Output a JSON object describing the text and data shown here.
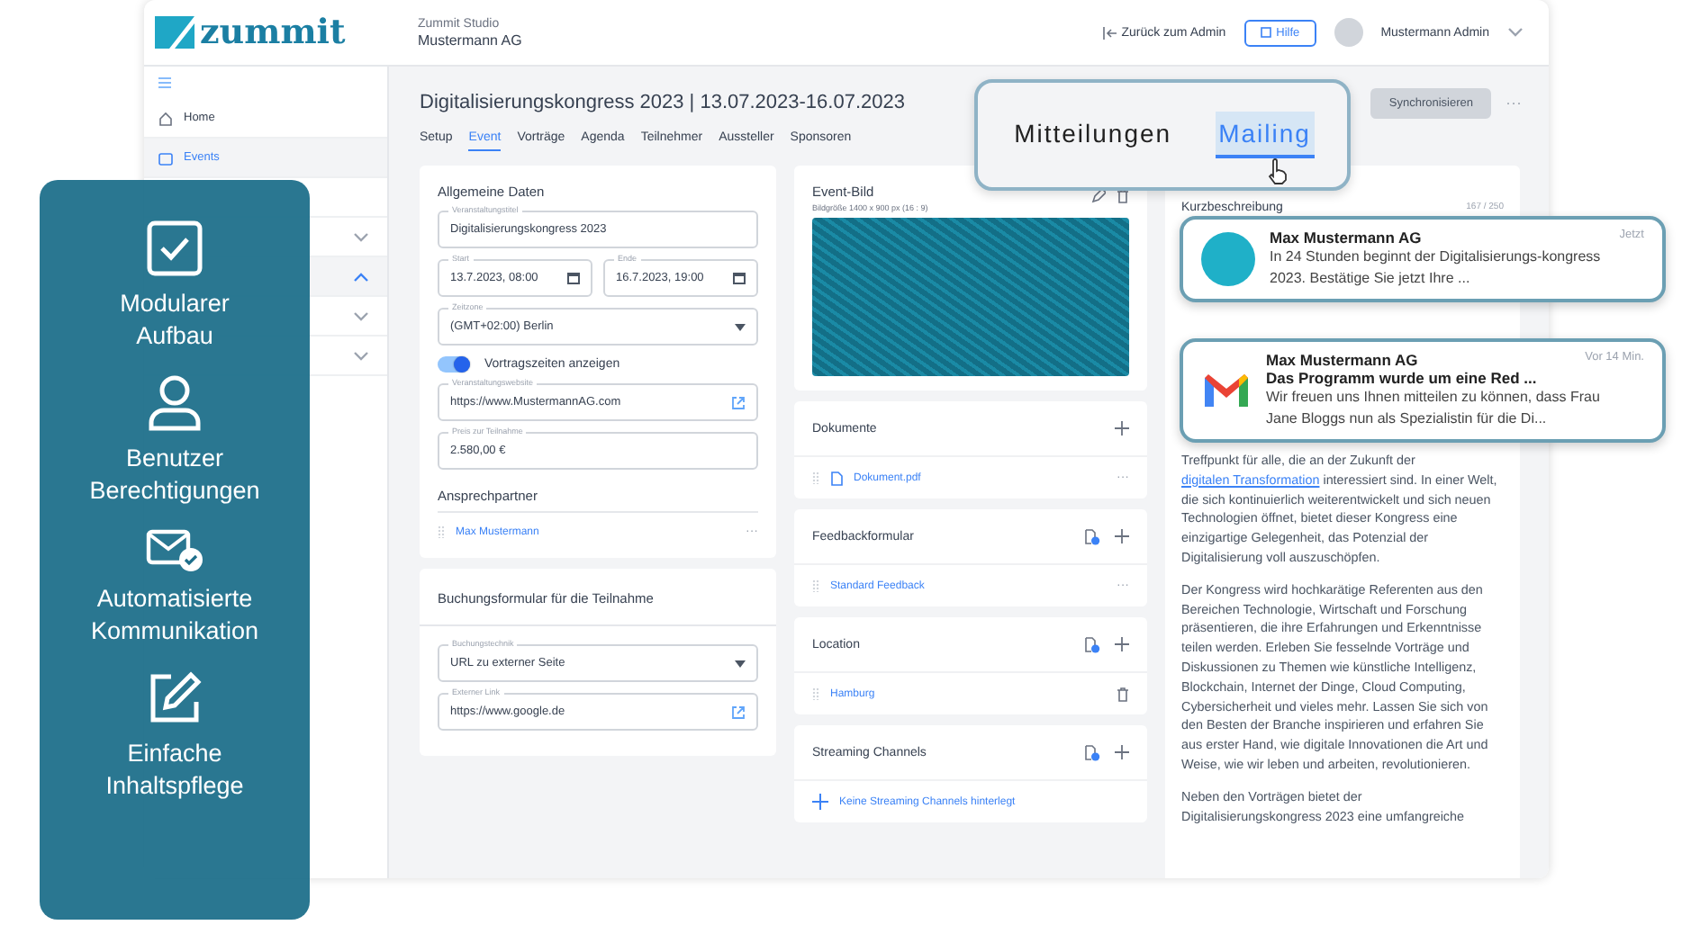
{
  "header": {
    "logo": "zummit",
    "studio": "Zummit Studio",
    "company": "Mustermann AG",
    "back_link": "Zurück zum Admin",
    "help_button": "Hilfe",
    "user": "Mustermann Admin"
  },
  "sidebar": {
    "items": [
      {
        "label": "Home",
        "selected": false
      },
      {
        "label": "Events",
        "selected": true
      },
      {
        "kind": "blank"
      },
      {
        "expanded": false
      },
      {
        "expanded": true
      },
      {
        "expanded": false
      },
      {
        "expanded": false
      }
    ]
  },
  "event": {
    "title": "Digitalisierungskongress 2023 | 13.07.2023-16.07.2023",
    "sync_button": "Synchronisieren",
    "more": "···"
  },
  "tabs": [
    {
      "label": "Setup",
      "selected": false
    },
    {
      "label": "Event",
      "selected": true
    },
    {
      "label": "Vorträge",
      "selected": false
    },
    {
      "label": "Agenda",
      "selected": false
    },
    {
      "label": "Teilnehmer",
      "selected": false
    },
    {
      "label": "Aussteller",
      "selected": false
    },
    {
      "label": "Sponsoren",
      "selected": false
    }
  ],
  "general": {
    "title": "Allgemeine Daten",
    "fields": [
      {
        "kind": "text",
        "label": "Veranstaltungstitel",
        "value": "Digitalisierungskongress 2023"
      },
      {
        "kind": "dates",
        "items": [
          {
            "label": "Start",
            "value": "13.7.2023, 08:00"
          },
          {
            "label": "Ende",
            "value": "16.7.2023, 19:00"
          }
        ]
      },
      {
        "kind": "select",
        "label": "Zeitzone",
        "value": "(GMT+02:00) Berlin"
      },
      {
        "kind": "toggle",
        "label": "Vortragszeiten anzeigen",
        "on": true
      },
      {
        "kind": "link",
        "label": "Veranstaltungswebsite",
        "value": "https://www.MustermannAG.com"
      },
      {
        "kind": "text",
        "label": "Preis zur Teilnahme",
        "value": "2.580,00 €"
      }
    ],
    "contact_title": "Ansprechpartner",
    "contact": "Max Mustermann",
    "contact_menu": "···"
  },
  "booking": {
    "title": "Buchungsformular für die Teilnahme",
    "fields": [
      {
        "kind": "select",
        "label": "Buchungstechnik",
        "value": "URL zu externer Seite"
      },
      {
        "kind": "link",
        "label": "Externer Link",
        "value": "https://www.google.de"
      }
    ]
  },
  "image_card": {
    "title": "Event-Bild",
    "hint": "Bildgröße 1400 x 900 px (16 : 9)"
  },
  "sections": [
    {
      "title": "Dokumente",
      "upload": false,
      "item": {
        "label": "Dokument.pdf",
        "kind": "file",
        "menu": "···"
      }
    },
    {
      "title": "Feedbackformular",
      "upload": true,
      "item": {
        "label": "Standard Feedback",
        "kind": "more",
        "menu": "···"
      }
    },
    {
      "title": "Location",
      "upload": true,
      "item": {
        "label": "Hamburg",
        "kind": "trash"
      }
    },
    {
      "title": "Streaming Channels",
      "upload": true,
      "item": {
        "label": "Keine Streaming Channels hinterlegt",
        "kind": "empty"
      }
    }
  ],
  "description": {
    "title": "Kurzbeschreibung",
    "counter": "167 / 250",
    "paragraphs": [
      {
        "before": "Treffpunkt für alle, die an der Zukunft der ",
        "link": "digitalen Transformation",
        "after": " interessiert sind. In einer Welt, die sich kontinuierlich weiterentwickelt und sich neuen Technologien öffnet, bietet dieser Kongress eine einzigartige Gelegenheit, das Potenzial der Digitalisierung voll auszuschöpfen."
      },
      {
        "before": "Der Kongress wird hochkarätige Referenten aus den Bereichen Technologie, Wirtschaft und Forschung präsentieren, die ihre Erfahrungen und Erkenntnisse teilen werden. Erleben Sie fesselnde Vorträge und Diskussionen zu Themen wie künstliche Intelligenz, Blockchain, Internet der Dinge, Cloud Computing, Cybersicherheit und vieles mehr. Lassen Sie sich von den Besten der Branche inspirieren und erfahren Sie aus erster Hand, wie digitale Innovationen die Art und Weise, wie wir leben und arbeiten, revolutionieren."
      },
      {
        "before": "Neben den Vorträgen bietet der Digitalisierungskongress 2023 eine umfangreiche"
      }
    ]
  },
  "features": [
    {
      "label": "Modularer Aufbau"
    },
    {
      "label": "Benutzer Berechtigungen"
    },
    {
      "label": "Automatisierte Kommunikation"
    },
    {
      "label": "Einfache Inhaltspflege"
    }
  ],
  "popup_tabs": [
    {
      "label": "Mitteilungen",
      "selected": false
    },
    {
      "label": "Mailing",
      "selected": true
    }
  ],
  "notifications": [
    {
      "sender": "Max Mustermann AG",
      "time": "Jetzt",
      "text": "In 24 Stunden beginnt der Digitalisierungs-kongress 2023. Bestätige Sie jetzt Ihre ..."
    },
    {
      "sender": "Max Mustermann AG",
      "time": "Vor 14 Min.",
      "subject": "Das Programm wurde um eine Red ...",
      "text": "Wir freuen uns Ihnen mitteilen zu können, dass Frau Jane Bloggs nun als Spezialistin für die Di..."
    }
  ]
}
